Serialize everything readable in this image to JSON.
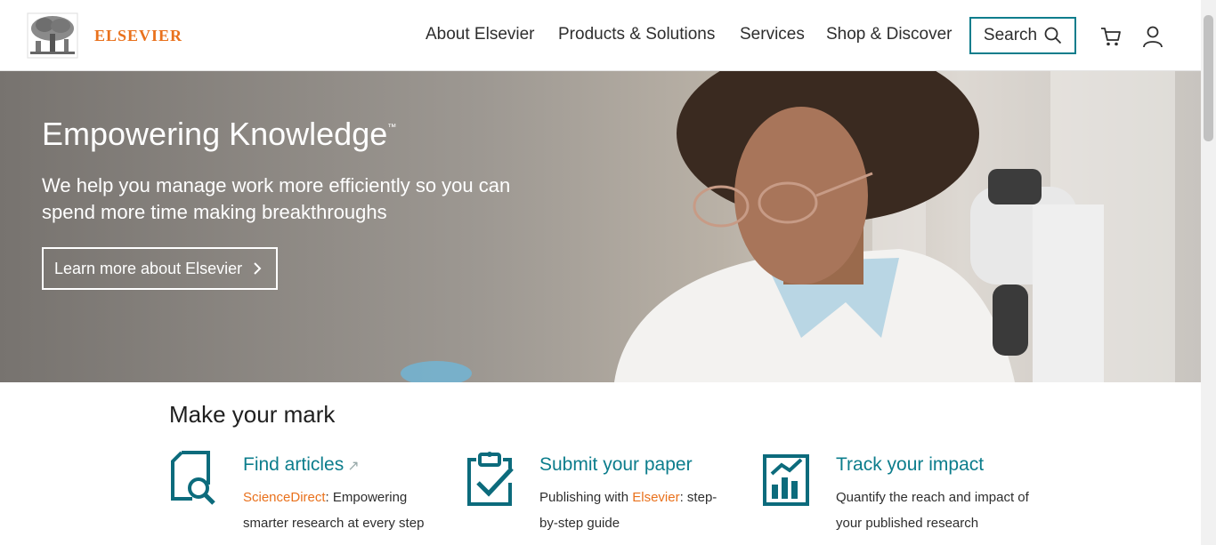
{
  "brand": {
    "name": "ELSEVIER",
    "color": "#e9711c",
    "logo_icon": "tree-logo-icon"
  },
  "nav": {
    "items": [
      "About Elsevier",
      "Products & Solutions",
      "Services",
      "Shop & Discover"
    ],
    "search_label": "Search",
    "cart_icon": "cart-icon",
    "account_icon": "account-icon",
    "accent": "#0c7d8c"
  },
  "hero": {
    "title": "Empowering Knowledge",
    "trademark": "™",
    "subtitle": "We help you manage work more efficiently so you can spend more time making breakthroughs",
    "cta_label": "Learn more about Elsevier"
  },
  "mark": {
    "title": "Make your mark",
    "cards": [
      {
        "title": "Find articles",
        "link_text": "ScienceDirect",
        "desc_rest": ": Empowering smarter research at every step",
        "icon": "document-search-icon"
      },
      {
        "title": "Submit your paper",
        "desc_pre": "Publishing with ",
        "link_text": "Elsevier",
        "desc_rest": ": step-by-step guide",
        "icon": "clipboard-check-icon"
      },
      {
        "title": "Track your impact",
        "desc": "Quantify the reach and impact of your published research",
        "icon": "bar-chart-icon"
      }
    ]
  }
}
